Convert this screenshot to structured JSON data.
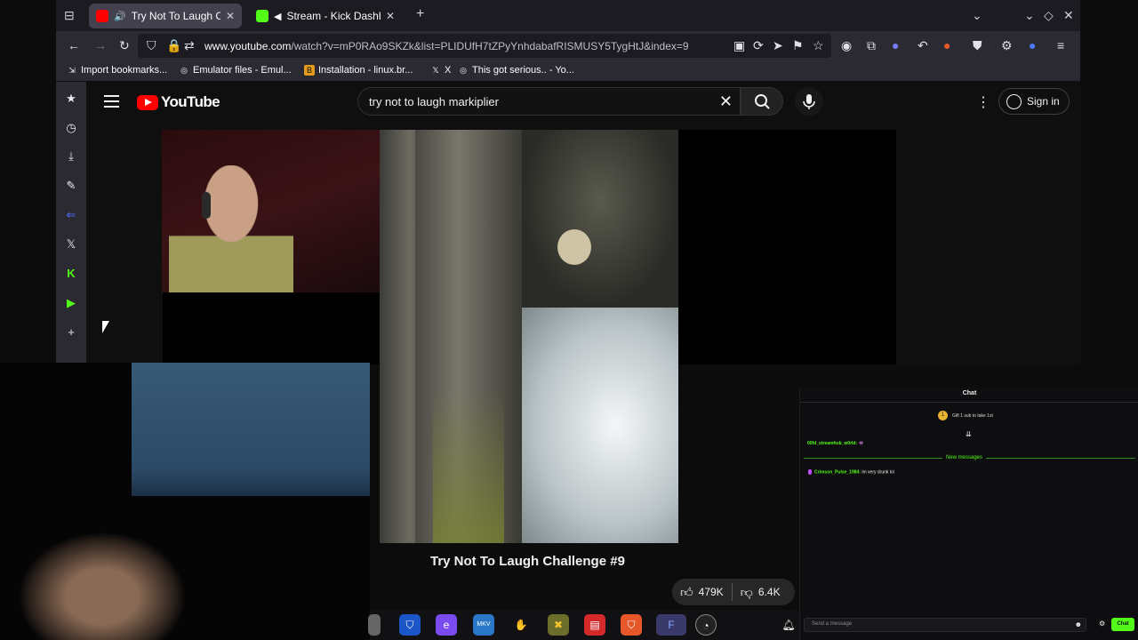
{
  "browser": {
    "tabs": [
      {
        "title": "Try Not To Laugh Challe",
        "active": true,
        "audio": true,
        "favicon_color": "#ff0000"
      },
      {
        "title": "Stream - Kick Dashboar",
        "active": false,
        "audio": true,
        "favicon_color": "#53fc18"
      }
    ],
    "new_tab_label": "+",
    "url_host": "www.youtube.com",
    "url_path": "/watch?v=mP0RAo9SKZk&list=PLIDUfH7tZPyYnhdabafRISMUSY5TygHtJ&index=9",
    "bookmarks": [
      {
        "label": "Import bookmarks...",
        "icon": "import-icon"
      },
      {
        "label": "Emulator files - Emul...",
        "icon": "globe-icon"
      },
      {
        "label": "Installation - linux.br...",
        "icon": "b-icon"
      },
      {
        "label": "X",
        "icon": "x-logo-icon"
      },
      {
        "label": "This got serious.. - Yo...",
        "icon": "globe-icon"
      }
    ]
  },
  "youtube": {
    "logo_text": "YouTube",
    "search_query": "try not to laugh markiplier",
    "signin_label": "Sign in",
    "video_title": "Try Not To Laugh Challenge #9",
    "likes": "479K",
    "dislikes": "6.4K"
  },
  "chat": {
    "header": "Chat",
    "pinned": "Gift 1 sub to take 1st",
    "pinned_badge": "1",
    "messages": [
      {
        "user": "00fd_streamhub_w0rld:",
        "text": ""
      },
      {
        "user": "Crimson_Pulse_1984:",
        "text": "im very drunk lol"
      }
    ],
    "new_messages_label": "New messages",
    "input_placeholder": "Send a message",
    "send_label": "Chat"
  },
  "colors": {
    "youtube_red": "#ff0000",
    "kick_green": "#53fc18",
    "browser_bg": "#1c1b22"
  }
}
